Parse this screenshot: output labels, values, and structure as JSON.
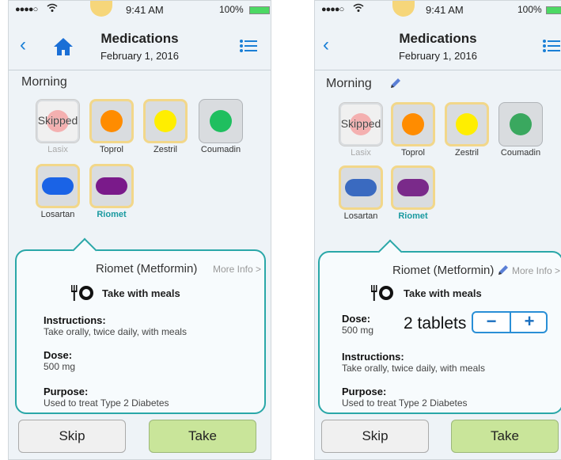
{
  "status": {
    "signal": "●●●●○",
    "time": "9:41 AM",
    "battery": "100%"
  },
  "nav": {
    "title": "Medications",
    "date": "February 1, 2016"
  },
  "section": {
    "title": "Morning"
  },
  "meds": [
    {
      "name": "Lasix",
      "state": "skipped",
      "pill_shape": "round",
      "color": "#f4a0a0",
      "tile_text": "Skipped"
    },
    {
      "name": "Toprol",
      "state": "taken",
      "pill_shape": "round",
      "color": "#ff8c00"
    },
    {
      "name": "Zestril",
      "state": "taken",
      "pill_shape": "round",
      "color": "#ffee00"
    },
    {
      "name": "Coumadin",
      "state": "pending",
      "pill_shape": "round",
      "color": "#1fbf5f"
    },
    {
      "name": "Losartan",
      "state": "taken",
      "pill_shape": "oblong",
      "color": "#1a63e6"
    },
    {
      "name": "Riomet",
      "state": "selected",
      "pill_shape": "oblong",
      "color": "#7a1a8a"
    }
  ],
  "detail": {
    "name": "Riomet (Metformin)",
    "more_info": "More Info >",
    "meal_note": "Take with meals",
    "dose_label": "Dose:",
    "dose_value": "500 mg",
    "dose_quantity": "2 tablets",
    "stepper_minus": "−",
    "stepper_plus": "+",
    "instructions_label": "Instructions:",
    "instructions_value": "Take orally, twice daily, with meals",
    "purpose_label": "Purpose:",
    "purpose_value": "Used to treat Type 2 Diabetes"
  },
  "actions": {
    "skip": "Skip",
    "take": "Take"
  },
  "colors": {
    "accent": "#1a7fd6",
    "detail_border": "#2aa7a8",
    "take_button": "#c9e59a",
    "selected_label": "#1a9aa0"
  }
}
